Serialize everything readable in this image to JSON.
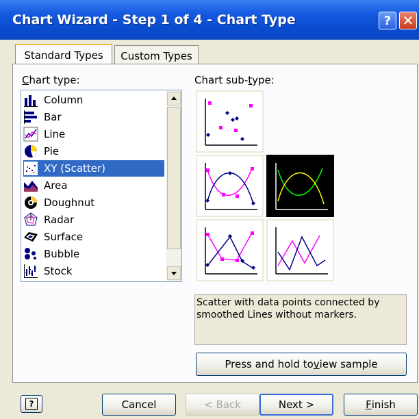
{
  "window": {
    "title": "Chart Wizard - Step 1 of 4 - Chart Type"
  },
  "titlebar": {
    "help_glyph": "?",
    "close_glyph": "✕"
  },
  "tabs": [
    {
      "label": "Standard Types",
      "active": true
    },
    {
      "label": "Custom Types",
      "active": false
    }
  ],
  "chart_type": {
    "label_underlined": "C",
    "label_rest": "hart type:",
    "items": [
      {
        "label": "Column",
        "icon": "column-chart-icon"
      },
      {
        "label": "Bar",
        "icon": "bar-chart-icon"
      },
      {
        "label": "Line",
        "icon": "line-chart-icon"
      },
      {
        "label": "Pie",
        "icon": "pie-chart-icon"
      },
      {
        "label": "XY (Scatter)",
        "icon": "scatter-chart-icon",
        "selected": true
      },
      {
        "label": "Area",
        "icon": "area-chart-icon"
      },
      {
        "label": "Doughnut",
        "icon": "doughnut-chart-icon"
      },
      {
        "label": "Radar",
        "icon": "radar-chart-icon"
      },
      {
        "label": "Surface",
        "icon": "surface-chart-icon"
      },
      {
        "label": "Bubble",
        "icon": "bubble-chart-icon"
      },
      {
        "label": "Stock",
        "icon": "stock-chart-icon"
      }
    ]
  },
  "subtype": {
    "label_before": "Chart sub-",
    "label_underlined": "t",
    "label_after": "ype:",
    "options": [
      {
        "name": "scatter-markers-only"
      },
      {
        "name": "scatter-smoothed-with-markers"
      },
      {
        "name": "scatter-smoothed-without-markers",
        "selected": true
      },
      {
        "name": "scatter-lines-with-markers"
      },
      {
        "name": "scatter-lines-without-markers"
      }
    ]
  },
  "description": "Scatter with data points connected by smoothed Lines without markers.",
  "buttons": {
    "sample_before": "Press and hold to ",
    "sample_underlined": "v",
    "sample_after": "iew sample",
    "help_icon": "?",
    "cancel": "Cancel",
    "back": "< Back",
    "next": "Next >",
    "finish_underlined": "F",
    "finish_rest": "inish"
  },
  "colors": {
    "selection": "#316ac5",
    "title_bar": "#0a4ccf",
    "accent_magenta": "#ff00ff",
    "accent_navy": "#000080"
  }
}
